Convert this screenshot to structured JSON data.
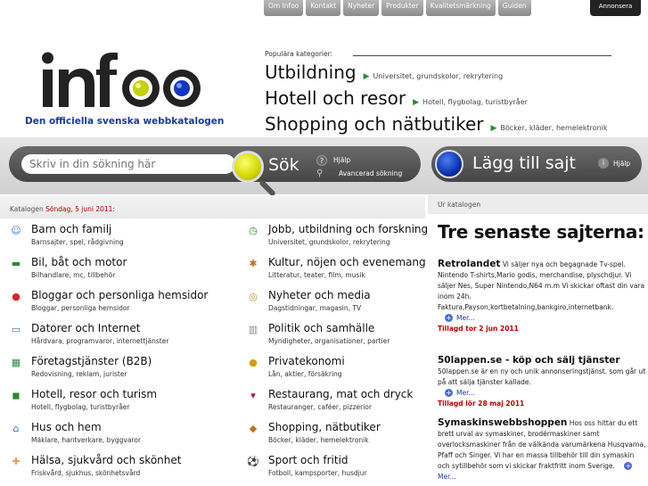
{
  "topnav": {
    "items": [
      "Om Infoo",
      "Kontakt",
      "Nyheter",
      "Produkter",
      "Kvalitetsmärkning",
      "Guiden"
    ],
    "annonsera": "Annonsera"
  },
  "header": {
    "logo": "infoo",
    "tagline": "Den officiella svenska webbkatalogen"
  },
  "popular": {
    "title": "Populära kategorier:",
    "rows": [
      {
        "big": "Utbildning",
        "sub": "Universitet, grundskolor, rekrytering"
      },
      {
        "big": "Hotell och resor",
        "sub": "Hotell, flygbolag, turistbyråer"
      },
      {
        "big": "Shopping och nätbutiker",
        "sub": "Böcker, kläder, hemelektronik"
      }
    ]
  },
  "search": {
    "placeholder": "Skriv in din sökning här",
    "button": "Sök",
    "help": "Hjälp",
    "advanced": "Avancerad sökning"
  },
  "add_site": {
    "label": "Lägg till sajt",
    "help": "Hjälp"
  },
  "catalog": {
    "label": "Katalogen",
    "date": "Söndag, 5 juni 2011:",
    "left": [
      {
        "name": "Barn och familj",
        "desc": "Barnsajter, spel, rådgivning",
        "icon": "family-icon"
      },
      {
        "name": "Bil, båt och motor",
        "desc": "Bilhandlare, mc, tillbehör",
        "icon": "car-icon"
      },
      {
        "name": "Bloggar och personliga hemsidor",
        "desc": "Bloggar, personliga hemsidor",
        "icon": "speech-bubble-icon"
      },
      {
        "name": "Datorer och Internet",
        "desc": "Hårdvara, programvaror, internettjänster",
        "icon": "computer-icon"
      },
      {
        "name": "Företagstjänster (B2B)",
        "desc": "Redovisning, reklam, jurister",
        "icon": "chart-icon"
      },
      {
        "name": "Hotell, resor och turism",
        "desc": "Hotell, flygbolag, turistbyråer",
        "icon": "suitcase-icon"
      },
      {
        "name": "Hus och hem",
        "desc": "Mäklare, hantverkare, byggvaror",
        "icon": "house-icon"
      },
      {
        "name": "Hälsa, sjukvård och skönhet",
        "desc": "Friskvård, sjukhus, skönhetsvård",
        "icon": "bandage-icon"
      }
    ],
    "right": [
      {
        "name": "Jobb, utbildning och forskning",
        "desc": "Universitet, grundskolor, rekrytering",
        "icon": "clock-icon"
      },
      {
        "name": "Kultur, nöjen och evenemang",
        "desc": "Litteratur, teater, film, musik",
        "icon": "palette-icon"
      },
      {
        "name": "Nyheter och media",
        "desc": "Dagstidningar, magasin, TV",
        "icon": "radio-icon"
      },
      {
        "name": "Politik och samhälle",
        "desc": "Myndigheter, organisationer, partier",
        "icon": "building-icon"
      },
      {
        "name": "Privatekonomi",
        "desc": "Lån, aktier, försäkring",
        "icon": "coins-icon"
      },
      {
        "name": "Restaurang, mat och dryck",
        "desc": "Restauranger, caféer, pizzerior",
        "icon": "wine-glass-icon"
      },
      {
        "name": "Shopping, nätbutiker",
        "desc": "Böcker, kläder, hemelektronik",
        "icon": "shopping-bag-icon"
      },
      {
        "name": "Sport och fritid",
        "desc": "Fotboll, kampsporter, husdjur",
        "icon": "football-icon"
      }
    ]
  },
  "latest": {
    "bar": "Ur katalogen",
    "title": "Tre senaste sajterna:",
    "more": "Mer...",
    "entries": [
      {
        "title": "Retrolandet",
        "text": " Vi säljer nya och begagnade Tv-spel. Nintendo T-shirts,Mario godis, merchandise, plyschdjur. Vi säljer Nes, Super Nintendo,N64 m.m Vi skickar oftast din vara inom 24h. Fakturа,Payson,kortbetalning,bankgiro,internetbank.",
        "added": "Tillagd tor 2 jun 2011"
      },
      {
        "title": "50lappen.se - köp och sälj tjänster",
        "text": " 50lappen.se är en ny och unik annonseringstjänst. som går ut på att sälja tjänster kallade.",
        "added": "Tillagd lör 28 maj 2011"
      },
      {
        "title": "Symaskinswebbshoppen",
        "text": " Hos oss hittar du ett brett urval av symaskiner, brodérmaskiner samt overlocksmaskiner från de välkända varumärkena Husqvarna, Pfaff och Singer. Vi har en massa tillbehör till din symaskin och sytillbehör som vi skickar fraktfritt inom Sverige.",
        "added": ""
      }
    ]
  }
}
